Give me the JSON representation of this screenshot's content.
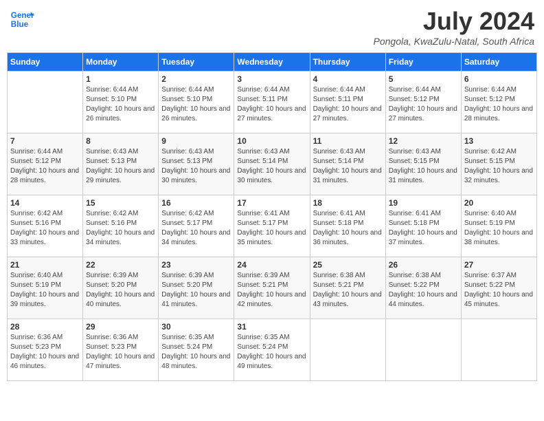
{
  "header": {
    "logo_line1": "General",
    "logo_line2": "Blue",
    "title": "July 2024",
    "subtitle": "Pongola, KwaZulu-Natal, South Africa"
  },
  "days_of_week": [
    "Sunday",
    "Monday",
    "Tuesday",
    "Wednesday",
    "Thursday",
    "Friday",
    "Saturday"
  ],
  "weeks": [
    [
      {
        "day": "",
        "sunrise": "",
        "sunset": "",
        "daylight": ""
      },
      {
        "day": "1",
        "sunrise": "Sunrise: 6:44 AM",
        "sunset": "Sunset: 5:10 PM",
        "daylight": "Daylight: 10 hours and 26 minutes."
      },
      {
        "day": "2",
        "sunrise": "Sunrise: 6:44 AM",
        "sunset": "Sunset: 5:10 PM",
        "daylight": "Daylight: 10 hours and 26 minutes."
      },
      {
        "day": "3",
        "sunrise": "Sunrise: 6:44 AM",
        "sunset": "Sunset: 5:11 PM",
        "daylight": "Daylight: 10 hours and 27 minutes."
      },
      {
        "day": "4",
        "sunrise": "Sunrise: 6:44 AM",
        "sunset": "Sunset: 5:11 PM",
        "daylight": "Daylight: 10 hours and 27 minutes."
      },
      {
        "day": "5",
        "sunrise": "Sunrise: 6:44 AM",
        "sunset": "Sunset: 5:12 PM",
        "daylight": "Daylight: 10 hours and 27 minutes."
      },
      {
        "day": "6",
        "sunrise": "Sunrise: 6:44 AM",
        "sunset": "Sunset: 5:12 PM",
        "daylight": "Daylight: 10 hours and 28 minutes."
      }
    ],
    [
      {
        "day": "7",
        "sunrise": "Sunrise: 6:44 AM",
        "sunset": "Sunset: 5:12 PM",
        "daylight": "Daylight: 10 hours and 28 minutes."
      },
      {
        "day": "8",
        "sunrise": "Sunrise: 6:43 AM",
        "sunset": "Sunset: 5:13 PM",
        "daylight": "Daylight: 10 hours and 29 minutes."
      },
      {
        "day": "9",
        "sunrise": "Sunrise: 6:43 AM",
        "sunset": "Sunset: 5:13 PM",
        "daylight": "Daylight: 10 hours and 30 minutes."
      },
      {
        "day": "10",
        "sunrise": "Sunrise: 6:43 AM",
        "sunset": "Sunset: 5:14 PM",
        "daylight": "Daylight: 10 hours and 30 minutes."
      },
      {
        "day": "11",
        "sunrise": "Sunrise: 6:43 AM",
        "sunset": "Sunset: 5:14 PM",
        "daylight": "Daylight: 10 hours and 31 minutes."
      },
      {
        "day": "12",
        "sunrise": "Sunrise: 6:43 AM",
        "sunset": "Sunset: 5:15 PM",
        "daylight": "Daylight: 10 hours and 31 minutes."
      },
      {
        "day": "13",
        "sunrise": "Sunrise: 6:42 AM",
        "sunset": "Sunset: 5:15 PM",
        "daylight": "Daylight: 10 hours and 32 minutes."
      }
    ],
    [
      {
        "day": "14",
        "sunrise": "Sunrise: 6:42 AM",
        "sunset": "Sunset: 5:16 PM",
        "daylight": "Daylight: 10 hours and 33 minutes."
      },
      {
        "day": "15",
        "sunrise": "Sunrise: 6:42 AM",
        "sunset": "Sunset: 5:16 PM",
        "daylight": "Daylight: 10 hours and 34 minutes."
      },
      {
        "day": "16",
        "sunrise": "Sunrise: 6:42 AM",
        "sunset": "Sunset: 5:17 PM",
        "daylight": "Daylight: 10 hours and 34 minutes."
      },
      {
        "day": "17",
        "sunrise": "Sunrise: 6:41 AM",
        "sunset": "Sunset: 5:17 PM",
        "daylight": "Daylight: 10 hours and 35 minutes."
      },
      {
        "day": "18",
        "sunrise": "Sunrise: 6:41 AM",
        "sunset": "Sunset: 5:18 PM",
        "daylight": "Daylight: 10 hours and 36 minutes."
      },
      {
        "day": "19",
        "sunrise": "Sunrise: 6:41 AM",
        "sunset": "Sunset: 5:18 PM",
        "daylight": "Daylight: 10 hours and 37 minutes."
      },
      {
        "day": "20",
        "sunrise": "Sunrise: 6:40 AM",
        "sunset": "Sunset: 5:19 PM",
        "daylight": "Daylight: 10 hours and 38 minutes."
      }
    ],
    [
      {
        "day": "21",
        "sunrise": "Sunrise: 6:40 AM",
        "sunset": "Sunset: 5:19 PM",
        "daylight": "Daylight: 10 hours and 39 minutes."
      },
      {
        "day": "22",
        "sunrise": "Sunrise: 6:39 AM",
        "sunset": "Sunset: 5:20 PM",
        "daylight": "Daylight: 10 hours and 40 minutes."
      },
      {
        "day": "23",
        "sunrise": "Sunrise: 6:39 AM",
        "sunset": "Sunset: 5:20 PM",
        "daylight": "Daylight: 10 hours and 41 minutes."
      },
      {
        "day": "24",
        "sunrise": "Sunrise: 6:39 AM",
        "sunset": "Sunset: 5:21 PM",
        "daylight": "Daylight: 10 hours and 42 minutes."
      },
      {
        "day": "25",
        "sunrise": "Sunrise: 6:38 AM",
        "sunset": "Sunset: 5:21 PM",
        "daylight": "Daylight: 10 hours and 43 minutes."
      },
      {
        "day": "26",
        "sunrise": "Sunrise: 6:38 AM",
        "sunset": "Sunset: 5:22 PM",
        "daylight": "Daylight: 10 hours and 44 minutes."
      },
      {
        "day": "27",
        "sunrise": "Sunrise: 6:37 AM",
        "sunset": "Sunset: 5:22 PM",
        "daylight": "Daylight: 10 hours and 45 minutes."
      }
    ],
    [
      {
        "day": "28",
        "sunrise": "Sunrise: 6:36 AM",
        "sunset": "Sunset: 5:23 PM",
        "daylight": "Daylight: 10 hours and 46 minutes."
      },
      {
        "day": "29",
        "sunrise": "Sunrise: 6:36 AM",
        "sunset": "Sunset: 5:23 PM",
        "daylight": "Daylight: 10 hours and 47 minutes."
      },
      {
        "day": "30",
        "sunrise": "Sunrise: 6:35 AM",
        "sunset": "Sunset: 5:24 PM",
        "daylight": "Daylight: 10 hours and 48 minutes."
      },
      {
        "day": "31",
        "sunrise": "Sunrise: 6:35 AM",
        "sunset": "Sunset: 5:24 PM",
        "daylight": "Daylight: 10 hours and 49 minutes."
      },
      {
        "day": "",
        "sunrise": "",
        "sunset": "",
        "daylight": ""
      },
      {
        "day": "",
        "sunrise": "",
        "sunset": "",
        "daylight": ""
      },
      {
        "day": "",
        "sunrise": "",
        "sunset": "",
        "daylight": ""
      }
    ]
  ]
}
